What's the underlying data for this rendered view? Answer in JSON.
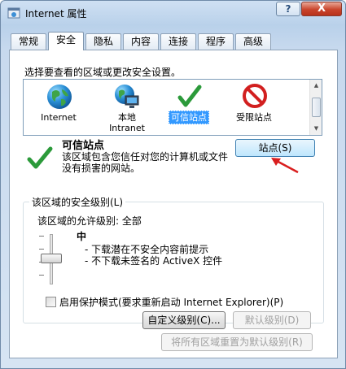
{
  "window": {
    "title": "Internet 属性",
    "help_label": "?",
    "close_label": "X"
  },
  "tabs": [
    {
      "label": "常规",
      "active": false
    },
    {
      "label": "安全",
      "active": true
    },
    {
      "label": "隐私",
      "active": false
    },
    {
      "label": "内容",
      "active": false
    },
    {
      "label": "连接",
      "active": false
    },
    {
      "label": "程序",
      "active": false
    },
    {
      "label": "高级",
      "active": false
    }
  ],
  "security": {
    "instruction": "选择要查看的区域或更改安全设置。",
    "zones": [
      {
        "label_line1": "Internet",
        "label_line2": "",
        "icon": "globe-icon",
        "selected": false
      },
      {
        "label_line1": "本地",
        "label_line2": "Intranet",
        "icon": "local-intranet-icon",
        "selected": false
      },
      {
        "label_line1": "可信站点",
        "label_line2": "",
        "icon": "checkmark-icon",
        "selected": true
      },
      {
        "label_line1": "受限站点",
        "label_line2": "",
        "icon": "restricted-icon",
        "selected": false
      }
    ],
    "selected_zone": {
      "title": "可信站点",
      "description": "该区域包含您信任对您的计算机或文件没有损害的网站。"
    },
    "sites_button": "站点(S)",
    "level_group": {
      "legend": "该区域的安全级别(L)",
      "allowed_levels": "该区域的允许级别: 全部",
      "level_name": "中",
      "bullets": [
        "- 下载潜在不安全内容前提示",
        "- 不下载未签名的 ActiveX 控件"
      ],
      "protected_mode_label": "启用保护模式(要求重新启动 Internet Explorer)(P)",
      "protected_mode_checked": false,
      "custom_level_button": "自定义级别(C)...",
      "default_level_button": "默认级别(D)"
    },
    "reset_all_button": "将所有区域重置为默认级别(R)"
  },
  "colors": {
    "accent_selection": "#3399ff",
    "arrow_annotation": "#d91e1e"
  }
}
